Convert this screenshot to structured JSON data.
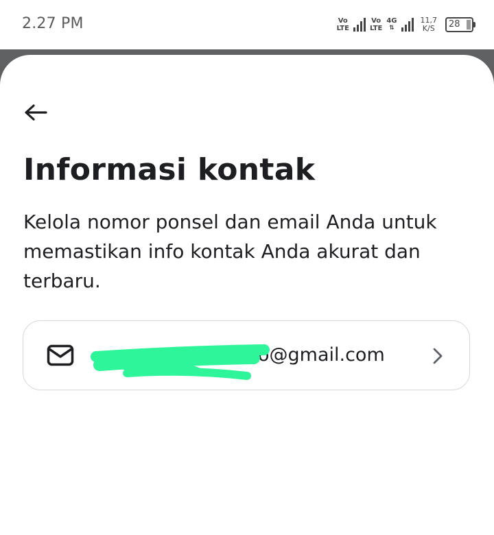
{
  "status_bar": {
    "time": "2.27 PM",
    "sim1_label_top": "Vo",
    "sim1_label_bottom": "LTE",
    "sim2_label_top": "Vo",
    "sim2_label_bottom": "LTE",
    "network_type": "4G",
    "speed_value": "11,7",
    "speed_unit": "K/S",
    "battery_level": "28"
  },
  "header": {
    "back_icon": "arrow-left-icon",
    "title": "Informasi kontak",
    "description": "Kelola nomor ponsel dan email Anda untuk memastikan info kontak Anda akurat dan terbaru."
  },
  "contact_item": {
    "icon": "mail-icon",
    "email_visible": "o@gmail.com",
    "chevron_icon": "chevron-right-icon",
    "redaction_color": "#2ff59a"
  },
  "colors": {
    "text": "#1c1e21",
    "sheet_backdrop": "#5f6062",
    "card_border": "#d4d8dd"
  }
}
